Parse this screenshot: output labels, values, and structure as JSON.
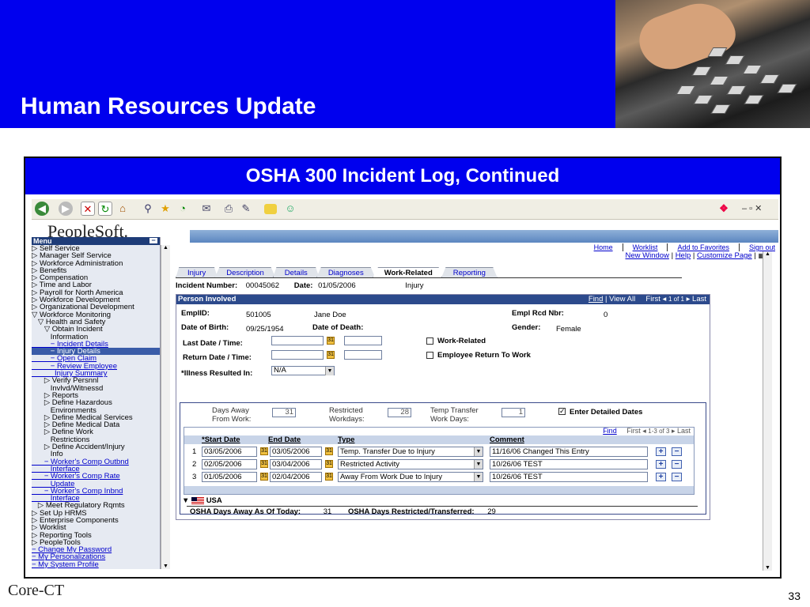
{
  "slide": {
    "title": "Human Resources Update",
    "subtitle": "OSHA 300 Incident Log, Continued",
    "page_number": "33",
    "footer_logo": "Core-CT"
  },
  "browser": {
    "icons": [
      "back-icon",
      "forward-icon",
      "stop-icon",
      "refresh-icon",
      "home-icon",
      "search-icon",
      "favorites-icon",
      "history-icon",
      "mail-icon",
      "print-icon",
      "edit-icon",
      "folder-icon",
      "messenger-icon",
      "windows-logo-icon"
    ]
  },
  "ps": {
    "logo": "PeopleSoft.",
    "nav": [
      "Home",
      "Worklist",
      "Add to Favorites",
      "Sign out"
    ],
    "top_links": {
      "new_window": "New Window",
      "help": "Help",
      "customize": "Customize Page"
    },
    "menu_title": "Menu",
    "menu": [
      {
        "t": "▷ Self Service",
        "k": "n"
      },
      {
        "t": "▷ Manager Self Service",
        "k": "n"
      },
      {
        "t": "▷ Workforce Administration",
        "k": "n"
      },
      {
        "t": "▷ Benefits",
        "k": "n"
      },
      {
        "t": "▷ Compensation",
        "k": "n"
      },
      {
        "t": "▷ Time and Labor",
        "k": "n"
      },
      {
        "t": "▷ Payroll for North America",
        "k": "n"
      },
      {
        "t": "▷ Workforce Development",
        "k": "n"
      },
      {
        "t": "▷ Organizational Development",
        "k": "n"
      },
      {
        "t": "▽ Workforce Monitoring",
        "k": "n"
      },
      {
        "t": "   ▽ Health and Safety",
        "k": "n"
      },
      {
        "t": "      ▽ Obtain Incident",
        "k": "n"
      },
      {
        "t": "         Information",
        "k": "n"
      },
      {
        "t": "         − Incident Details",
        "k": "l"
      },
      {
        "t": "         − Injury Details",
        "k": "s"
      },
      {
        "t": "         − Open Claim",
        "k": "l"
      },
      {
        "t": "         − Review Employee",
        "k": "l"
      },
      {
        "t": "           Injury Summary",
        "k": "l"
      },
      {
        "t": "      ▷ Verify Persnnl",
        "k": "n"
      },
      {
        "t": "         Invlvd/Witnessd",
        "k": "n"
      },
      {
        "t": "      ▷ Reports",
        "k": "n"
      },
      {
        "t": "      ▷ Define Hazardous",
        "k": "n"
      },
      {
        "t": "         Environments",
        "k": "n"
      },
      {
        "t": "      ▷ Define Medical Services",
        "k": "n"
      },
      {
        "t": "      ▷ Define Medical Data",
        "k": "n"
      },
      {
        "t": "      ▷ Define Work",
        "k": "n"
      },
      {
        "t": "         Restrictions",
        "k": "n"
      },
      {
        "t": "      ▷ Define Accident/Injury",
        "k": "n"
      },
      {
        "t": "         Info",
        "k": "n"
      },
      {
        "t": "      − Worker's Comp Outbnd",
        "k": "l"
      },
      {
        "t": "         Interface",
        "k": "l"
      },
      {
        "t": "      − Worker's Comp Rate",
        "k": "l"
      },
      {
        "t": "         Update",
        "k": "l"
      },
      {
        "t": "      − Worker's Comp Inbnd",
        "k": "l"
      },
      {
        "t": "         Interface",
        "k": "l"
      },
      {
        "t": "   ▷ Meet Regulatory Rqmts",
        "k": "n"
      },
      {
        "t": "▷ Set Up HRMS",
        "k": "n"
      },
      {
        "t": "▷ Enterprise Components",
        "k": "n"
      },
      {
        "t": "▷ Worklist",
        "k": "n"
      },
      {
        "t": "▷ Reporting Tools",
        "k": "n"
      },
      {
        "t": "▷ PeopleTools",
        "k": "n"
      },
      {
        "t": "− Change My Password",
        "k": "l"
      },
      {
        "t": "− My Personalizations",
        "k": "l"
      },
      {
        "t": "− My System Profile",
        "k": "l"
      }
    ],
    "tabs": [
      "Injury",
      "Description",
      "Details",
      "Diagnoses",
      "Work-Related",
      "Reporting"
    ],
    "incident": {
      "num_label": "Incident Number:",
      "num": "00045062",
      "date_label": "Date:",
      "date": "01/05/2006",
      "type": "Injury"
    },
    "pi": {
      "title": "Person Involved",
      "find": "Find",
      "view_all": "View All",
      "first": "First",
      "count": "1 of 1",
      "last": "Last",
      "emplid_label": "EmplID:",
      "emplid": "501005",
      "name": "Jane Doe",
      "rcd_label": "Empl Rcd Nbr:",
      "rcd": "0",
      "dob_label": "Date of Birth:",
      "dob": "09/25/1954",
      "dod_label": "Date of Death:",
      "gender_label": "Gender:",
      "gender": "Female",
      "last_date_label": "Last Date / Time:",
      "return_label": "Return Date / Time:",
      "work_related": "Work-Related",
      "emp_return": "Employee Return To Work",
      "illness_label": "*Illness Resulted In:",
      "illness": "N/A"
    },
    "days": {
      "away_label1": "Days Away",
      "away_label2": "From Work:",
      "away": "31",
      "restr_label1": "Restricted",
      "restr_label2": "Workdays:",
      "restr": "28",
      "temp_label1": "Temp Transfer",
      "temp_label2": "Work Days:",
      "temp": "1",
      "enter_dates": "Enter Detailed Dates",
      "find": "Find",
      "first": "First",
      "count": "1-3 of 3",
      "last": "Last",
      "cols": [
        "*Start Date",
        "End Date",
        "Type",
        "Comment"
      ],
      "rows": [
        {
          "n": "1",
          "start": "03/05/2006",
          "end": "03/05/2006",
          "type": "Temp. Transfer Due to Injury",
          "comment": "11/16/06 Changed This Entry"
        },
        {
          "n": "2",
          "start": "02/05/2006",
          "end": "03/04/2006",
          "type": "Restricted Activity",
          "comment": "10/26/06 TEST"
        },
        {
          "n": "3",
          "start": "01/05/2006",
          "end": "02/04/2006",
          "type": "Away From Work Due to Injury",
          "comment": "10/26/06 TEST"
        }
      ],
      "country": "USA",
      "osha_away_label": "OSHA Days Away As Of Today:",
      "osha_away": "31",
      "osha_restr_label": "OSHA Days Restricted/Transferred:",
      "osha_restr": "29"
    }
  }
}
